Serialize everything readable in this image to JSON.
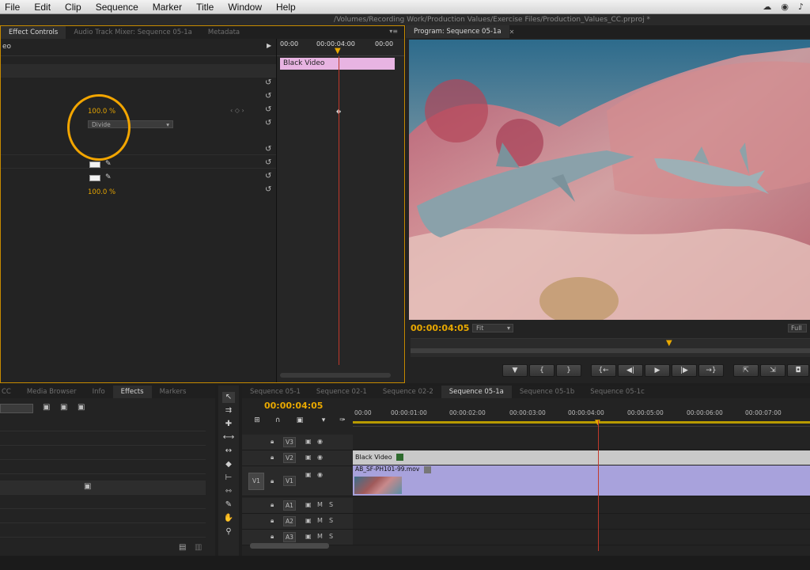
{
  "menubar": {
    "items": [
      "File",
      "Edit",
      "Clip",
      "Sequence",
      "Marker",
      "Title",
      "Window",
      "Help"
    ]
  },
  "titlebar": {
    "path": "/Volumes/Recording Work/Production Values/Exercise Files/Production_Values_CC.prproj *"
  },
  "effect_controls": {
    "tabs": [
      "Effect Controls",
      "Audio Track Mixer: Sequence 05-1a",
      "Metadata"
    ],
    "title_fragment": "eo",
    "ruler": {
      "start": "00:00",
      "mid": "00:00:04:00",
      "end": "00:00"
    },
    "clip_label": "Black Video",
    "opacity_value": "100.0 %",
    "blend_mode": "Divide",
    "bottom_value": "100.0 %"
  },
  "program": {
    "tab": "Program: Sequence 05-1a",
    "timecode": "00:00:04:05",
    "fit": "Fit",
    "resolution": "Full"
  },
  "transport_buttons": [
    "marker",
    "in",
    "out",
    "go-to-in",
    "step-back",
    "play",
    "step-forward",
    "go-to-out",
    "insert",
    "overwrite",
    "export-frame"
  ],
  "effects_panel": {
    "tabs": [
      "CC",
      "Media Browser",
      "Info",
      "Effects",
      "Markers"
    ]
  },
  "timeline": {
    "tabs": [
      "Sequence 05-1",
      "Sequence 02-1",
      "Sequence 02-2",
      "Sequence 05-1a",
      "Sequence 05-1b",
      "Sequence 05-1c"
    ],
    "timecode": "00:00:04:05",
    "ruler": [
      "00:00",
      "00:00:01:00",
      "00:00:02:00",
      "00:00:03:00",
      "00:00:04:00",
      "00:00:05:00",
      "00:00:06:00",
      "00:00:07:00"
    ],
    "tracks": {
      "v1": "V1",
      "v2": "V2",
      "v3": "V3",
      "source_v": "V1",
      "a1": "A1",
      "a2": "A2",
      "a3": "A3"
    },
    "clip_black": "Black Video",
    "clip_video": "AB_SF-PH101-99.mov"
  }
}
